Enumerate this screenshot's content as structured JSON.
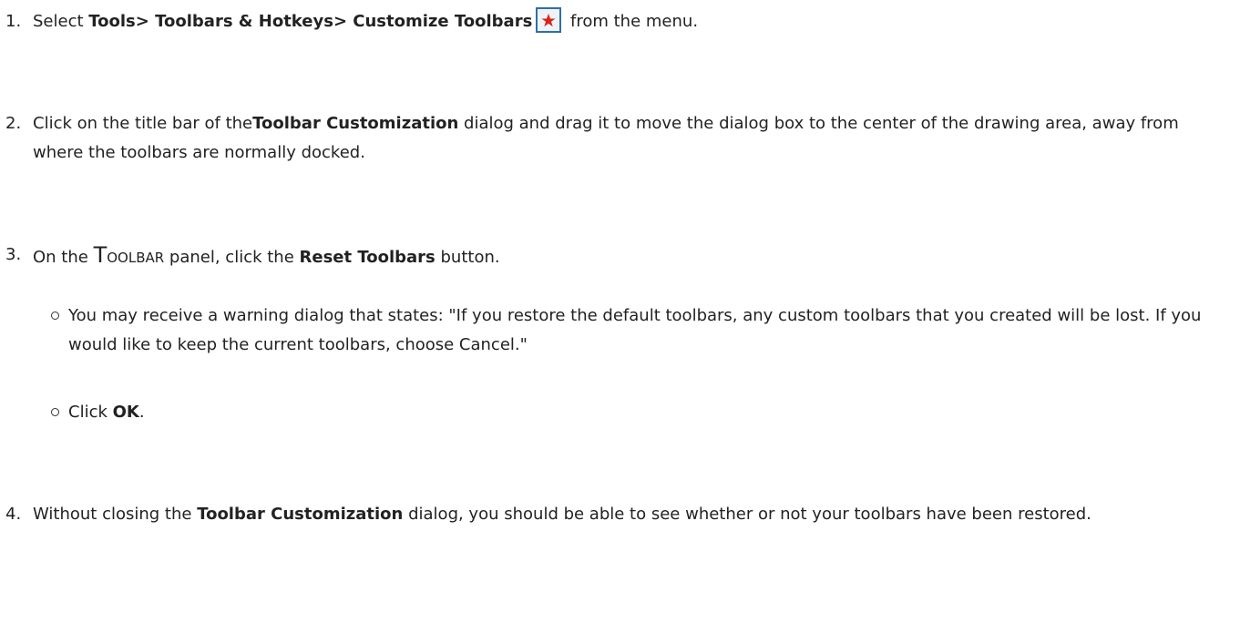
{
  "steps": [
    {
      "number": "1.",
      "text_a": "Select ",
      "bold_a": "Tools> Toolbars & Hotkeys> Customize Toolbars",
      "icon": "customize-toolbars-star-icon",
      "text_b": " from the menu."
    },
    {
      "number": "2.",
      "text_a": "Click on the title bar of the",
      "bold_a": "Toolbar Customization",
      "text_b": " dialog and drag it to move the dialog box to the center of the drawing area, away from where the toolbars are normally docked."
    },
    {
      "number": "3.",
      "text_a": "On the ",
      "caps_big": "T",
      "caps_small": "OOLBAR",
      "text_b": " panel, click the ",
      "bold_a": "Reset Toolbars",
      "text_c": " button."
    },
    {
      "number": "4.",
      "text_a": "Without closing the ",
      "bold_a": "Toolbar Customization",
      "text_b": " dialog, you should be able to see whether or not your toolbars have been restored."
    }
  ],
  "bullets": [
    {
      "text": "You may receive a warning dialog that states: \"If you restore the default toolbars, any custom toolbars that you created will be lost. If you would like to keep the current toolbars, choose Cancel.\""
    },
    {
      "text_a": "Click ",
      "bold_a": "OK",
      "text_b": "."
    }
  ],
  "colors": {
    "text": "#222222",
    "icon_border": "#2f6fa8",
    "icon_bg": "#eef3f8",
    "icon_star": "#d8231c"
  }
}
